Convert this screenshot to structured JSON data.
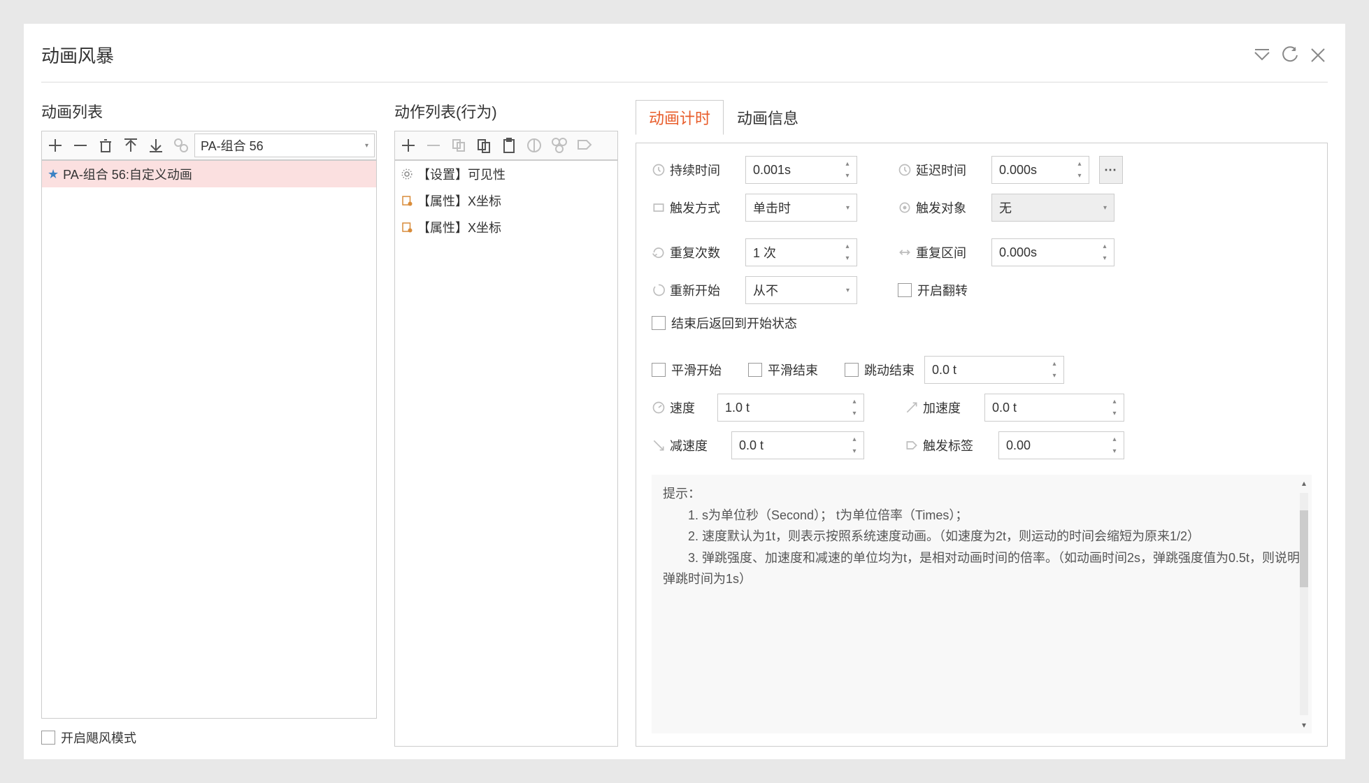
{
  "dialog": {
    "title": "动画风暴"
  },
  "anim": {
    "title": "动画列表",
    "combo": "PA-组合 56",
    "items": [
      "PA-组合 56:自定义动画"
    ]
  },
  "action": {
    "title": "动作列表(行为)",
    "items": [
      "【设置】可见性",
      "【属性】X坐标",
      "【属性】X坐标"
    ]
  },
  "tabs": {
    "timing": "动画计时",
    "info": "动画信息"
  },
  "form": {
    "duration": {
      "label": "持续时间",
      "value": "0.001s"
    },
    "delay": {
      "label": "延迟时间",
      "value": "0.000s"
    },
    "trigger": {
      "label": "触发方式",
      "value": "单击时"
    },
    "target": {
      "label": "触发对象",
      "value": "无"
    },
    "repeat": {
      "label": "重复次数",
      "value": "1 次"
    },
    "repeat_interval": {
      "label": "重复区间",
      "value": "0.000s"
    },
    "restart": {
      "label": "重新开始",
      "value": "从不"
    },
    "flip": {
      "label": "开启翻转"
    },
    "return_start": {
      "label": "结束后返回到开始状态"
    },
    "smooth_start": {
      "label": "平滑开始"
    },
    "smooth_end": {
      "label": "平滑结束"
    },
    "bounce_end": {
      "label": "跳动结束",
      "value": "0.0 t"
    },
    "speed": {
      "label": "速度",
      "value": "1.0 t"
    },
    "accel": {
      "label": "加速度",
      "value": "0.0 t"
    },
    "decel": {
      "label": "减速度",
      "value": "0.0 t"
    },
    "trigger_tag": {
      "label": "触发标签",
      "value": "0.00"
    }
  },
  "hint": {
    "title": "提示：",
    "l1": "1. s为单位秒（Second）；  t为单位倍率（Times）；",
    "l2": "2. 速度默认为1t，则表示按照系统速度动画。（如速度为2t，则运动的时间会缩短为原来1/2）",
    "l3": "3. 弹跳强度、加速度和减速的单位均为t，是相对动画时间的倍率。（如动画时间2s，弹跳强度值为0.5t，则说明弹跳时间为1s）"
  },
  "footer": {
    "storm_mode": "开启飓风模式"
  }
}
